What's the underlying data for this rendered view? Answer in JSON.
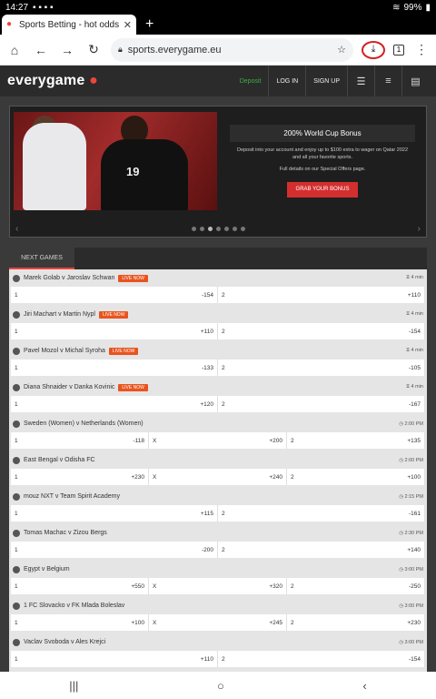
{
  "status": {
    "time": "14:27",
    "battery": "99%"
  },
  "browser": {
    "tab_title": "Sports Betting - hot odds",
    "url": "sports.everygame.eu",
    "tabs_count": "1"
  },
  "site": {
    "logo": "everygame",
    "deposit": "Deposit",
    "login": "LOG IN",
    "signup": "SIGN UP"
  },
  "banner": {
    "title": "200% World Cup Bonus",
    "text": "Deposit into your account and enjoy up to $100 extra to wager on Qatar 2022 and all your favorite sports.",
    "note": "Full details on our Special Offers page.",
    "button": "GRAB YOUR BONUS",
    "player_number": "19"
  },
  "games_header": "NEXT GAMES",
  "live_label": "LIVE NOW",
  "games": [
    {
      "name": "Marek Golab v Jaroslav Schwan",
      "live": true,
      "time": "4 min",
      "odds": [
        {
          "l": "1",
          "v": "-154"
        },
        {
          "l": "2",
          "v": "+110"
        }
      ]
    },
    {
      "name": "Jiri Machart v Martin Nypl",
      "live": true,
      "time": "4 min",
      "odds": [
        {
          "l": "1",
          "v": "+110"
        },
        {
          "l": "2",
          "v": "-154"
        }
      ]
    },
    {
      "name": "Pavel Mozol v Michal Syroha",
      "live": true,
      "time": "4 min",
      "odds": [
        {
          "l": "1",
          "v": "-133"
        },
        {
          "l": "2",
          "v": "-105"
        }
      ]
    },
    {
      "name": "Diana Shnaider v Danka Kovinic",
      "live": true,
      "time": "4 min",
      "odds": [
        {
          "l": "1",
          "v": "+120"
        },
        {
          "l": "2",
          "v": "-167"
        }
      ]
    },
    {
      "name": "Sweden (Women) v Netherlands (Women)",
      "live": false,
      "time": "2:00 PM",
      "odds": [
        {
          "l": "1",
          "v": "-118"
        },
        {
          "l": "X",
          "v": "+200"
        },
        {
          "l": "2",
          "v": "+135"
        }
      ]
    },
    {
      "name": "East Bengal v Odisha FC",
      "live": false,
      "time": "2:00 PM",
      "odds": [
        {
          "l": "1",
          "v": "+230"
        },
        {
          "l": "X",
          "v": "+240"
        },
        {
          "l": "2",
          "v": "+100"
        }
      ]
    },
    {
      "name": "mouz NXT v Team Spirit Academy",
      "live": false,
      "time": "2:15 PM",
      "odds": [
        {
          "l": "1",
          "v": "+115"
        },
        {
          "l": "2",
          "v": "-161"
        }
      ]
    },
    {
      "name": "Tomas Machac v Zizou Bergs",
      "live": false,
      "time": "2:30 PM",
      "odds": [
        {
          "l": "1",
          "v": "-200"
        },
        {
          "l": "2",
          "v": "+140"
        }
      ]
    },
    {
      "name": "Egypt v Belgium",
      "live": false,
      "time": "3:00 PM",
      "odds": [
        {
          "l": "1",
          "v": "+550"
        },
        {
          "l": "X",
          "v": "+320"
        },
        {
          "l": "2",
          "v": "-250"
        }
      ]
    },
    {
      "name": "1 FC Slovacko v FK Mlada Boleslav",
      "live": false,
      "time": "3:00 PM",
      "odds": [
        {
          "l": "1",
          "v": "+100"
        },
        {
          "l": "X",
          "v": "+245"
        },
        {
          "l": "2",
          "v": "+230"
        }
      ]
    },
    {
      "name": "Vaclav Svoboda v Ales Krejci",
      "live": false,
      "time": "3:00 PM",
      "odds": [
        {
          "l": "1",
          "v": "+110"
        },
        {
          "l": "2",
          "v": "-154"
        }
      ]
    }
  ]
}
